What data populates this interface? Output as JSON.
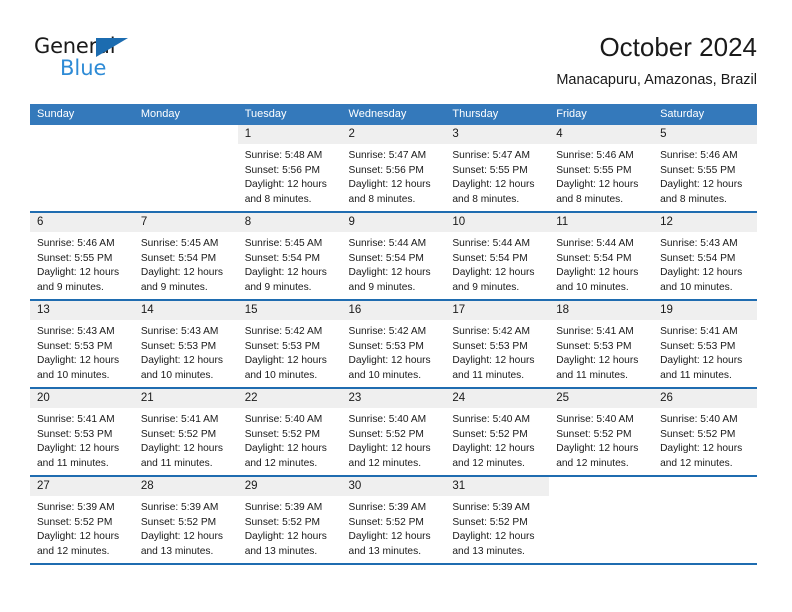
{
  "brand": {
    "name_top": "General",
    "name_bottom": "Blue",
    "triangle_color": "#1c6cb0",
    "blue_text_color": "#2e8bd6"
  },
  "header": {
    "title": "October 2024",
    "subtitle": "Manacapuru, Amazonas, Brazil"
  },
  "theme": {
    "header_blue": "#3479bb",
    "divider_blue": "#1f6cb0",
    "day_strip_gray": "#efefef"
  },
  "weekday_headers": [
    "Sunday",
    "Monday",
    "Tuesday",
    "Wednesday",
    "Thursday",
    "Friday",
    "Saturday"
  ],
  "weeks": [
    [
      {
        "day": "",
        "empty": true,
        "sunrise": "",
        "sunset": "",
        "daylight_line1": "",
        "daylight_line2": ""
      },
      {
        "day": "",
        "empty": true,
        "sunrise": "",
        "sunset": "",
        "daylight_line1": "",
        "daylight_line2": ""
      },
      {
        "day": "1",
        "sunrise": "Sunrise: 5:48 AM",
        "sunset": "Sunset: 5:56 PM",
        "daylight_line1": "Daylight: 12 hours",
        "daylight_line2": "and 8 minutes."
      },
      {
        "day": "2",
        "sunrise": "Sunrise: 5:47 AM",
        "sunset": "Sunset: 5:56 PM",
        "daylight_line1": "Daylight: 12 hours",
        "daylight_line2": "and 8 minutes."
      },
      {
        "day": "3",
        "sunrise": "Sunrise: 5:47 AM",
        "sunset": "Sunset: 5:55 PM",
        "daylight_line1": "Daylight: 12 hours",
        "daylight_line2": "and 8 minutes."
      },
      {
        "day": "4",
        "sunrise": "Sunrise: 5:46 AM",
        "sunset": "Sunset: 5:55 PM",
        "daylight_line1": "Daylight: 12 hours",
        "daylight_line2": "and 8 minutes."
      },
      {
        "day": "5",
        "sunrise": "Sunrise: 5:46 AM",
        "sunset": "Sunset: 5:55 PM",
        "daylight_line1": "Daylight: 12 hours",
        "daylight_line2": "and 8 minutes."
      }
    ],
    [
      {
        "day": "6",
        "sunrise": "Sunrise: 5:46 AM",
        "sunset": "Sunset: 5:55 PM",
        "daylight_line1": "Daylight: 12 hours",
        "daylight_line2": "and 9 minutes."
      },
      {
        "day": "7",
        "sunrise": "Sunrise: 5:45 AM",
        "sunset": "Sunset: 5:54 PM",
        "daylight_line1": "Daylight: 12 hours",
        "daylight_line2": "and 9 minutes."
      },
      {
        "day": "8",
        "sunrise": "Sunrise: 5:45 AM",
        "sunset": "Sunset: 5:54 PM",
        "daylight_line1": "Daylight: 12 hours",
        "daylight_line2": "and 9 minutes."
      },
      {
        "day": "9",
        "sunrise": "Sunrise: 5:44 AM",
        "sunset": "Sunset: 5:54 PM",
        "daylight_line1": "Daylight: 12 hours",
        "daylight_line2": "and 9 minutes."
      },
      {
        "day": "10",
        "sunrise": "Sunrise: 5:44 AM",
        "sunset": "Sunset: 5:54 PM",
        "daylight_line1": "Daylight: 12 hours",
        "daylight_line2": "and 9 minutes."
      },
      {
        "day": "11",
        "sunrise": "Sunrise: 5:44 AM",
        "sunset": "Sunset: 5:54 PM",
        "daylight_line1": "Daylight: 12 hours",
        "daylight_line2": "and 10 minutes."
      },
      {
        "day": "12",
        "sunrise": "Sunrise: 5:43 AM",
        "sunset": "Sunset: 5:54 PM",
        "daylight_line1": "Daylight: 12 hours",
        "daylight_line2": "and 10 minutes."
      }
    ],
    [
      {
        "day": "13",
        "sunrise": "Sunrise: 5:43 AM",
        "sunset": "Sunset: 5:53 PM",
        "daylight_line1": "Daylight: 12 hours",
        "daylight_line2": "and 10 minutes."
      },
      {
        "day": "14",
        "sunrise": "Sunrise: 5:43 AM",
        "sunset": "Sunset: 5:53 PM",
        "daylight_line1": "Daylight: 12 hours",
        "daylight_line2": "and 10 minutes."
      },
      {
        "day": "15",
        "sunrise": "Sunrise: 5:42 AM",
        "sunset": "Sunset: 5:53 PM",
        "daylight_line1": "Daylight: 12 hours",
        "daylight_line2": "and 10 minutes."
      },
      {
        "day": "16",
        "sunrise": "Sunrise: 5:42 AM",
        "sunset": "Sunset: 5:53 PM",
        "daylight_line1": "Daylight: 12 hours",
        "daylight_line2": "and 10 minutes."
      },
      {
        "day": "17",
        "sunrise": "Sunrise: 5:42 AM",
        "sunset": "Sunset: 5:53 PM",
        "daylight_line1": "Daylight: 12 hours",
        "daylight_line2": "and 11 minutes."
      },
      {
        "day": "18",
        "sunrise": "Sunrise: 5:41 AM",
        "sunset": "Sunset: 5:53 PM",
        "daylight_line1": "Daylight: 12 hours",
        "daylight_line2": "and 11 minutes."
      },
      {
        "day": "19",
        "sunrise": "Sunrise: 5:41 AM",
        "sunset": "Sunset: 5:53 PM",
        "daylight_line1": "Daylight: 12 hours",
        "daylight_line2": "and 11 minutes."
      }
    ],
    [
      {
        "day": "20",
        "sunrise": "Sunrise: 5:41 AM",
        "sunset": "Sunset: 5:53 PM",
        "daylight_line1": "Daylight: 12 hours",
        "daylight_line2": "and 11 minutes."
      },
      {
        "day": "21",
        "sunrise": "Sunrise: 5:41 AM",
        "sunset": "Sunset: 5:52 PM",
        "daylight_line1": "Daylight: 12 hours",
        "daylight_line2": "and 11 minutes."
      },
      {
        "day": "22",
        "sunrise": "Sunrise: 5:40 AM",
        "sunset": "Sunset: 5:52 PM",
        "daylight_line1": "Daylight: 12 hours",
        "daylight_line2": "and 12 minutes."
      },
      {
        "day": "23",
        "sunrise": "Sunrise: 5:40 AM",
        "sunset": "Sunset: 5:52 PM",
        "daylight_line1": "Daylight: 12 hours",
        "daylight_line2": "and 12 minutes."
      },
      {
        "day": "24",
        "sunrise": "Sunrise: 5:40 AM",
        "sunset": "Sunset: 5:52 PM",
        "daylight_line1": "Daylight: 12 hours",
        "daylight_line2": "and 12 minutes."
      },
      {
        "day": "25",
        "sunrise": "Sunrise: 5:40 AM",
        "sunset": "Sunset: 5:52 PM",
        "daylight_line1": "Daylight: 12 hours",
        "daylight_line2": "and 12 minutes."
      },
      {
        "day": "26",
        "sunrise": "Sunrise: 5:40 AM",
        "sunset": "Sunset: 5:52 PM",
        "daylight_line1": "Daylight: 12 hours",
        "daylight_line2": "and 12 minutes."
      }
    ],
    [
      {
        "day": "27",
        "sunrise": "Sunrise: 5:39 AM",
        "sunset": "Sunset: 5:52 PM",
        "daylight_line1": "Daylight: 12 hours",
        "daylight_line2": "and 12 minutes."
      },
      {
        "day": "28",
        "sunrise": "Sunrise: 5:39 AM",
        "sunset": "Sunset: 5:52 PM",
        "daylight_line1": "Daylight: 12 hours",
        "daylight_line2": "and 13 minutes."
      },
      {
        "day": "29",
        "sunrise": "Sunrise: 5:39 AM",
        "sunset": "Sunset: 5:52 PM",
        "daylight_line1": "Daylight: 12 hours",
        "daylight_line2": "and 13 minutes."
      },
      {
        "day": "30",
        "sunrise": "Sunrise: 5:39 AM",
        "sunset": "Sunset: 5:52 PM",
        "daylight_line1": "Daylight: 12 hours",
        "daylight_line2": "and 13 minutes."
      },
      {
        "day": "31",
        "sunrise": "Sunrise: 5:39 AM",
        "sunset": "Sunset: 5:52 PM",
        "daylight_line1": "Daylight: 12 hours",
        "daylight_line2": "and 13 minutes."
      },
      {
        "day": "",
        "empty": true,
        "sunrise": "",
        "sunset": "",
        "daylight_line1": "",
        "daylight_line2": ""
      },
      {
        "day": "",
        "empty": true,
        "sunrise": "",
        "sunset": "",
        "daylight_line1": "",
        "daylight_line2": ""
      }
    ]
  ]
}
